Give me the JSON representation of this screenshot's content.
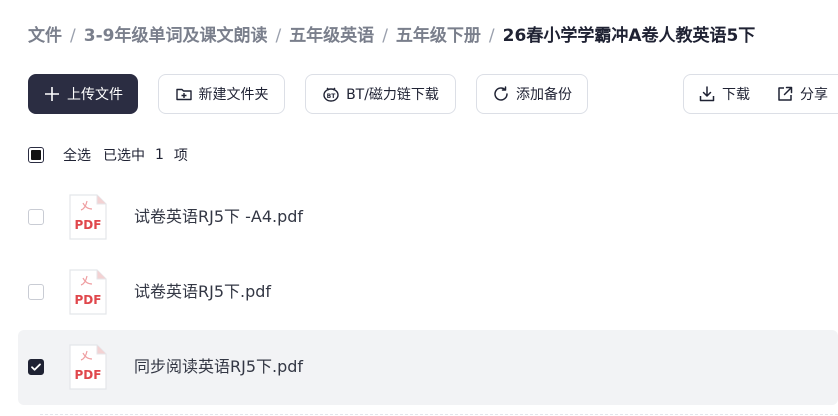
{
  "breadcrumb": {
    "items": [
      "文件",
      "3-9年级单词及课文朗读",
      "五年级英语",
      "五年级下册"
    ],
    "current": "26春小学学霸冲A卷人教英语5下",
    "separator": "/"
  },
  "toolbar": {
    "upload_label": "上传文件",
    "new_folder_label": "新建文件夹",
    "bt_label": "BT/磁力链下载",
    "backup_label": "添加备份",
    "download_label": "下载",
    "share_label": "分享"
  },
  "selection": {
    "select_all_label": "全选",
    "selected_prefix": "已选中",
    "selected_count": "1",
    "selected_suffix": "项"
  },
  "files": [
    {
      "name": "试卷英语RJ5下 -A4.pdf",
      "type_label": "PDF",
      "checked": false
    },
    {
      "name": "试卷英语RJ5下.pdf",
      "type_label": "PDF",
      "checked": false
    },
    {
      "name": "同步阅读英语RJ5下.pdf",
      "type_label": "PDF",
      "checked": true
    }
  ],
  "colors": {
    "primary": "#2b2d42",
    "pdf_red": "#e0474c",
    "selected_row": "#f2f3f5"
  }
}
